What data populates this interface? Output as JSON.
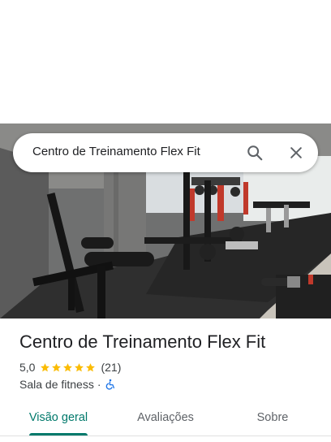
{
  "search": {
    "query": "Centro de Treinamento Flex Fit"
  },
  "place": {
    "name": "Centro de Treinamento Flex Fit",
    "rating": "5,0",
    "stars": 5,
    "review_count": "(21)",
    "category": "Sala de fitness",
    "separator": "·"
  },
  "tabs": [
    {
      "label": "Visão geral",
      "active": true
    },
    {
      "label": "Avaliações",
      "active": false
    },
    {
      "label": "Sobre",
      "active": false
    }
  ],
  "colors": {
    "accent": "#00796b",
    "star": "#fbbc04",
    "accessibility_icon": "#1a73e8"
  }
}
